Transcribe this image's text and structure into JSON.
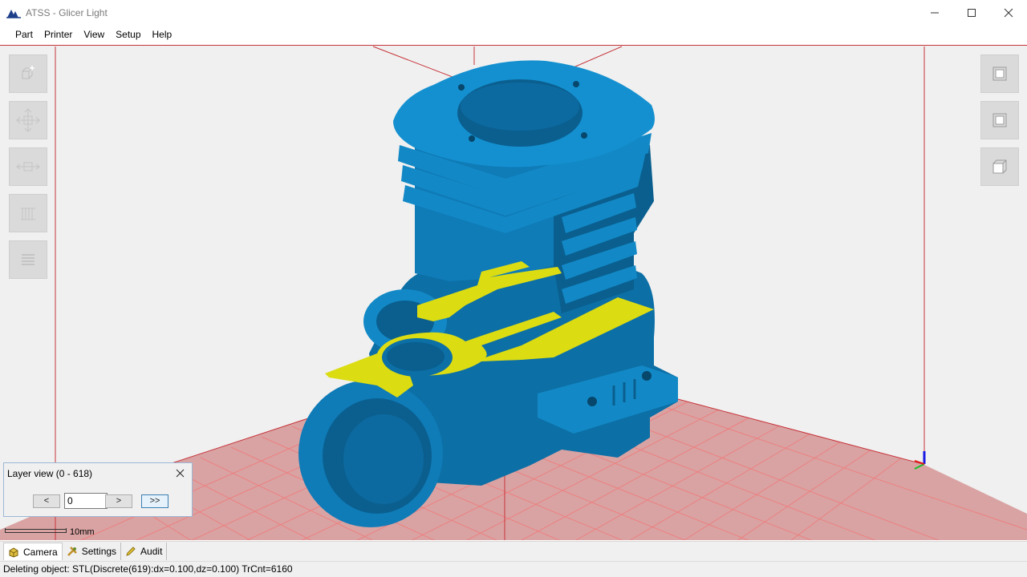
{
  "window": {
    "title": "ATSS - Glicer Light",
    "logo_icon": "atss-logo-icon",
    "minimize_icon": "minimize-icon",
    "maximize_icon": "maximize-icon",
    "close_icon": "close-icon"
  },
  "menu": {
    "items": [
      {
        "label": "Part"
      },
      {
        "label": "Printer"
      },
      {
        "label": "View"
      },
      {
        "label": "Setup"
      },
      {
        "label": "Help"
      }
    ]
  },
  "left_toolbar": {
    "buttons": [
      {
        "name": "add-part-button",
        "icon": "add-cube-icon"
      },
      {
        "name": "move-button",
        "icon": "move-arrows-icon"
      },
      {
        "name": "scale-button",
        "icon": "scale-icon"
      },
      {
        "name": "supports-button",
        "icon": "supports-icon"
      },
      {
        "name": "slice-button",
        "icon": "layers-icon"
      }
    ]
  },
  "right_toolbar": {
    "buttons": [
      {
        "name": "view-front-button",
        "icon": "front-view-icon"
      },
      {
        "name": "view-top-button",
        "icon": "top-view-icon"
      },
      {
        "name": "view-iso-button",
        "icon": "iso-view-icon"
      }
    ]
  },
  "viewport": {
    "part_color": "#1289c6",
    "slice_color": "#dcdc12",
    "bed_color": "#d9a3a3",
    "grid_color": "#f07a7a",
    "frame_color": "#c7343a"
  },
  "layer_view": {
    "title": "Layer view (0 - 618)",
    "prev_label": "<",
    "value": "0",
    "next_label": ">",
    "last_label": ">>"
  },
  "scale": {
    "label": "10mm"
  },
  "tabs": [
    {
      "label": "Camera",
      "icon": "camera-cube-icon",
      "active": true
    },
    {
      "label": "Settings",
      "icon": "settings-tools-icon",
      "active": false
    },
    {
      "label": "Audit",
      "icon": "audit-pencil-icon",
      "active": false
    }
  ],
  "status": {
    "message": "Deleting object: STL(Discrete(619):dx=0.100,dz=0.100) TrCnt=6160"
  }
}
